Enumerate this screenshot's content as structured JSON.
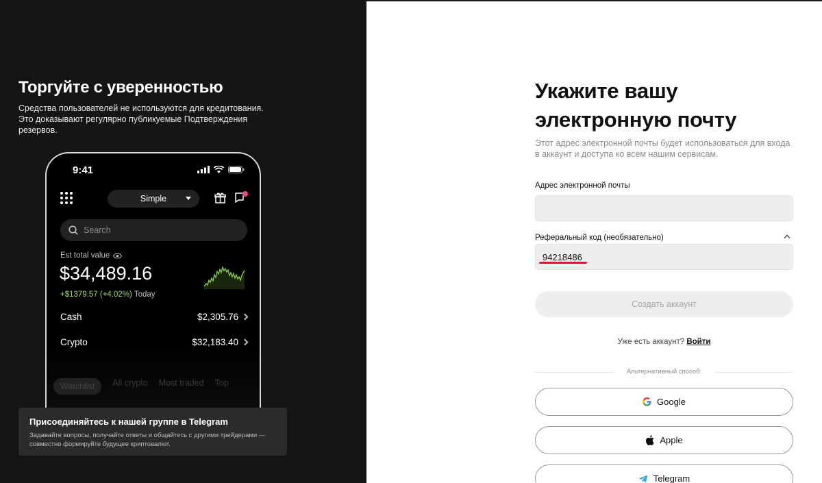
{
  "promo": {
    "title": "Торгуйте с уверенностью",
    "description": "Средства пользователей не используются для кредитования. Это доказывают регулярно публикуемые Подтверждения резервов."
  },
  "phone": {
    "time": "9:41",
    "mode": "Simple",
    "search_placeholder": "Search",
    "est_label": "Est total value",
    "total_value": "$34,489.16",
    "change": "+$1379.57 (+4.02%)",
    "change_period": "Today",
    "rows": [
      {
        "label": "Cash",
        "value": "$2,305.76"
      },
      {
        "label": "Crypto",
        "value": "$32,183.40"
      }
    ],
    "tabs": [
      "Watchlist",
      "All crypto",
      "Most traded",
      "Top"
    ]
  },
  "telegram_card": {
    "title": "Присоединяйтесь к нашей группе в Telegram",
    "description": "Задавайте вопросы, получайте ответы и общайтесь с другими трейдерами — совместно формируйте будущее криптовалют."
  },
  "form": {
    "heading": "Укажите вашу электронную почту",
    "subtitle": "Этот адрес электронной почты будет использоваться для входа в аккаунт и доступа ко всем нашим сервисам.",
    "email_label": "Адрес электронной почты",
    "email_value": "",
    "referral_label": "Реферальный код (необязательно)",
    "referral_value": "94218486",
    "create_button": "Создать аккаунт",
    "have_account": "Уже есть аккаунт?",
    "login_link": "Войти",
    "alt_label": "Альтернативный способ:",
    "social": [
      {
        "label": "Google",
        "icon": "google-icon"
      },
      {
        "label": "Apple",
        "icon": "apple-icon"
      },
      {
        "label": "Telegram",
        "icon": "telegram-icon"
      }
    ]
  },
  "colors": {
    "left_bg": "#151515",
    "accent_green": "#9fd86c",
    "notif_pink": "#f0488a",
    "annotation_red": "#e3102f"
  }
}
